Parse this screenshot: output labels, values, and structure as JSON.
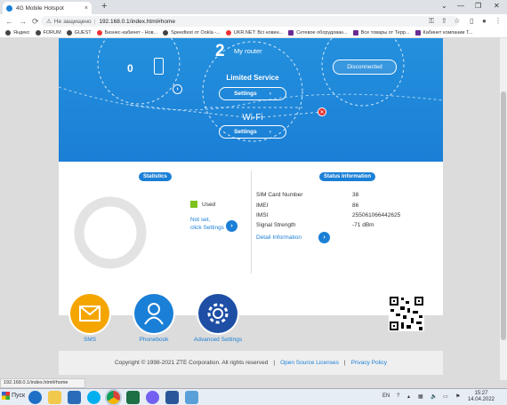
{
  "browser": {
    "tab_title": "4G Mobile Hotspot",
    "tab_close": "×",
    "new_tab": "+",
    "security_label": "Не защищено",
    "url": "192.168.0.1/index.html#home",
    "back_icon": "←",
    "forward_icon": "→",
    "reload_icon": "⟳"
  },
  "bookmarks": [
    "Яндекс",
    "FORUM",
    "GUEST",
    "Бизнес-кабинет - Нов...",
    "Speedtest от Ookla -...",
    "UKR.NET: Всі новин...",
    "Сетевое оборудован...",
    "Все товары от Терр...",
    "Кабинет компании Т..."
  ],
  "hero": {
    "center_number": "0",
    "badge_number": "2",
    "my_router": "My router",
    "internet_status": "Limited Service",
    "settings1": "Settings",
    "wifi": "Wi-Fi",
    "settings2": "Settings",
    "disconnected": "Disconnected"
  },
  "statistics": {
    "title": "Statistics",
    "legend_used": "Used",
    "not_set": "Not set,",
    "click_settings": "click Settings",
    "used_fraction": 0
  },
  "status_info": {
    "title": "Status Information",
    "rows": [
      {
        "label": "SIM Card Number",
        "value": "38"
      },
      {
        "label": "IMEI",
        "value": "86"
      },
      {
        "label": "IMSI",
        "value": "255061066442625"
      },
      {
        "label": "Signal Strength",
        "value": "-71 dBm"
      }
    ],
    "detail_link": "Detail Information"
  },
  "features": [
    {
      "label": "SMS"
    },
    {
      "label": "Phonebook"
    },
    {
      "label": "Advanced Settings"
    }
  ],
  "footer": {
    "copyright": "Copyright © 1998-2021 ZTE Corporation. All rights reserved",
    "sep": "|",
    "open_source": "Open Source Licenses",
    "privacy": "Privacy Policy"
  },
  "status_url": "192.168.0.1/index.html#home",
  "taskbar": {
    "start": "Пуск",
    "lang": "EN",
    "time": "15:27",
    "date": "14.04.2022"
  },
  "colors": {
    "accent": "#1a7fd6",
    "sms": "#f5a500",
    "used": "#7dc21e",
    "error": "#e03030"
  }
}
